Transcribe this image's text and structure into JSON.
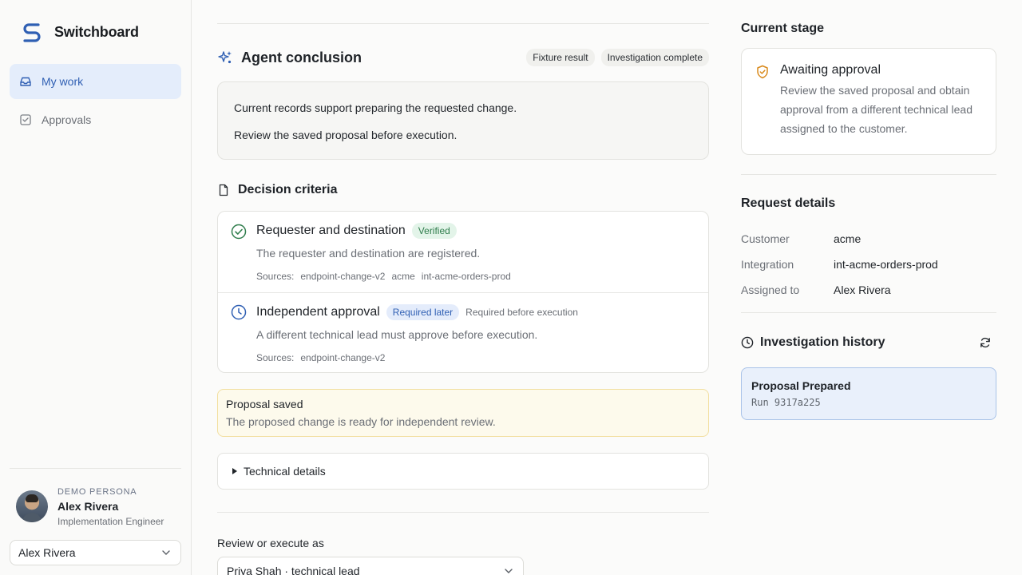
{
  "app": {
    "name": "Switchboard"
  },
  "sidebar": {
    "items": [
      {
        "label": "My work",
        "icon": "inbox-icon",
        "active": true
      },
      {
        "label": "Approvals",
        "icon": "checkbox-icon",
        "active": false
      }
    ],
    "persona": {
      "kicker": "DEMO PERSONA",
      "name": "Alex Rivera",
      "role": "Implementation Engineer",
      "selected": "Alex Rivera"
    }
  },
  "conclusion": {
    "title": "Agent conclusion",
    "chips": [
      "Fixture result",
      "Investigation complete"
    ],
    "lines": [
      "Current records support preparing the requested change.",
      "Review the saved proposal before execution."
    ]
  },
  "criteria": {
    "title": "Decision criteria",
    "items": [
      {
        "title": "Requester and destination",
        "badge": "Verified",
        "status_icon": "check-circle-icon",
        "note": "",
        "description": "The requester and destination are registered.",
        "sources_label": "Sources:",
        "sources": [
          "endpoint-change-v2",
          "acme",
          "int-acme-orders-prod"
        ]
      },
      {
        "title": "Independent approval",
        "badge": "Required later",
        "status_icon": "clock-icon",
        "note": "Required before execution",
        "description": "A different technical lead must approve before execution.",
        "sources_label": "Sources:",
        "sources": [
          "endpoint-change-v2"
        ]
      }
    ]
  },
  "proposal": {
    "title": "Proposal saved",
    "text": "The proposed change is ready for independent review."
  },
  "technical_details": {
    "label": "Technical details"
  },
  "review": {
    "label": "Review or execute as",
    "selected": "Priya Shah · technical lead"
  },
  "stage": {
    "heading": "Current stage",
    "title": "Awaiting approval",
    "description": "Review the saved proposal and obtain approval from a different technical lead assigned to the customer."
  },
  "request_details": {
    "heading": "Request details",
    "rows": [
      {
        "key": "Customer",
        "value": "acme"
      },
      {
        "key": "Integration",
        "value": "int-acme-orders-prod"
      },
      {
        "key": "Assigned to",
        "value": "Alex Rivera"
      }
    ]
  },
  "history": {
    "heading": "Investigation history",
    "runs": [
      {
        "title": "Proposal Prepared",
        "run": "Run 9317a225"
      }
    ]
  },
  "colors": {
    "accent": "#2f5fb3",
    "verified": "#2f7d4c",
    "warning": "#d98a1c"
  }
}
